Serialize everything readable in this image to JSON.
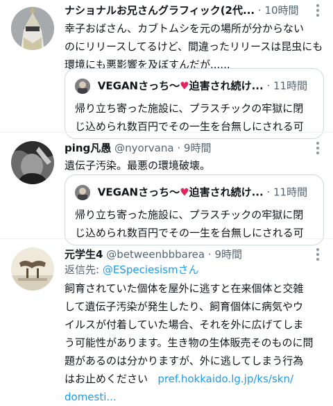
{
  "tweets": [
    {
      "name": "ナショナルお兄さんグラフィック(2代...",
      "dot": "·",
      "time": "10時間",
      "lines": [
        "幸子おばさん、カブトムシを元の場所が分からない",
        "のにリリースしてるけど、間違ったリリースは昆虫にも",
        "環境にも悪影響を及ぼすんだが......"
      ],
      "quote": {
        "name": "VEGANさっち〜",
        "heart": "♥",
        "name_suffix": "迫害され続け...",
        "time": "· 11時間",
        "lines": [
          "帰り立ち寄った施設に、プラスチックの牢獄に閉",
          "じ込められ数百円でその一生を台無しにされる可"
        ]
      }
    },
    {
      "name": "ping凡愚",
      "handle": "@nyorvana",
      "dot": "·",
      "time": "9時間",
      "lines": [
        "遺伝子汚染。最悪の環境破壊。"
      ],
      "quote": {
        "name": "VEGANさっち〜",
        "heart": "♥",
        "name_suffix": "迫害され続け...",
        "time": "· 11時間",
        "lines": [
          "帰り立ち寄った施設に、プラスチックの牢獄に閉",
          "じ込められ数百円でその一生を台無しにされる可"
        ]
      }
    },
    {
      "name": "元学生4",
      "handle": "@betweenbbbarea",
      "dot": "·",
      "time": "9時間",
      "reply_prefix": "返信先: ",
      "reply_mention": "@ESpeciesismさん",
      "lines": [
        "飼育されていた個体を屋外に逃すと在来個体と交雑",
        "して遺伝子汚染が発生したり、飼育個体に病気やウ",
        "イルスが付着していた場合、それを外に広げてしま",
        "う可能性があります。生き物の生体販売そのものに問",
        "題があるのは分かりますが、外に逃してしまう行為",
        "はお止めください"
      ],
      "link_1": "pref.hokkaido.lg.jp/ks/skn/",
      "link_2": "domesti..."
    }
  ],
  "colors": {
    "accent": "#1d9bf0",
    "heart": "#e0245e",
    "muted": "#536471"
  }
}
